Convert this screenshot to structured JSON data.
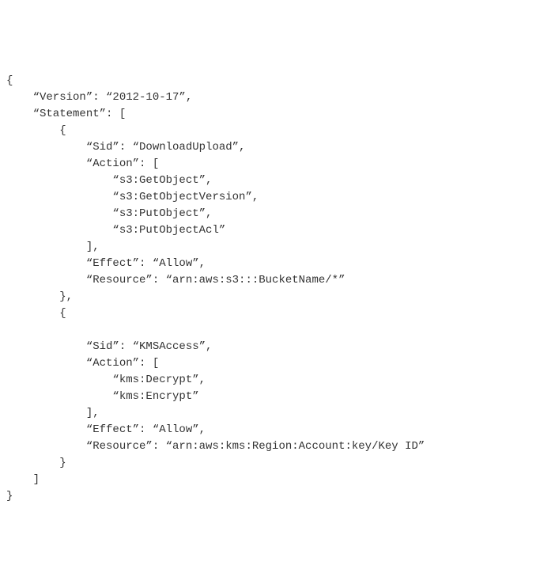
{
  "policy": {
    "line01": "{",
    "line02": "    “Version”: “2012-10-17”,",
    "line03": "    “Statement”: [",
    "line04": "        {",
    "line05": "            “Sid”: “DownloadUpload”,",
    "line06": "            “Action”: [",
    "line07": "                “s3:GetObject”,",
    "line08": "                “s3:GetObjectVersion”,",
    "line09": "                “s3:PutObject”,",
    "line10": "                “s3:PutObjectAcl”",
    "line11": "            ],",
    "line12": "            “Effect”: “Allow”,",
    "line13": "            “Resource”: “arn:aws:s3:::BucketName/*”",
    "line14": "        },",
    "line15": "        {",
    "line16": "",
    "line17": "            “Sid”: “KMSAccess”,",
    "line18": "            “Action”: [",
    "line19": "                “kms:Decrypt”,",
    "line20": "                “kms:Encrypt”",
    "line21": "            ],",
    "line22": "            “Effect”: “Allow”,",
    "line23": "            “Resource”: “arn:aws:kms:Region:Account:key/Key ID”",
    "line24": "        }",
    "line25": "    ]",
    "line26": "}"
  }
}
